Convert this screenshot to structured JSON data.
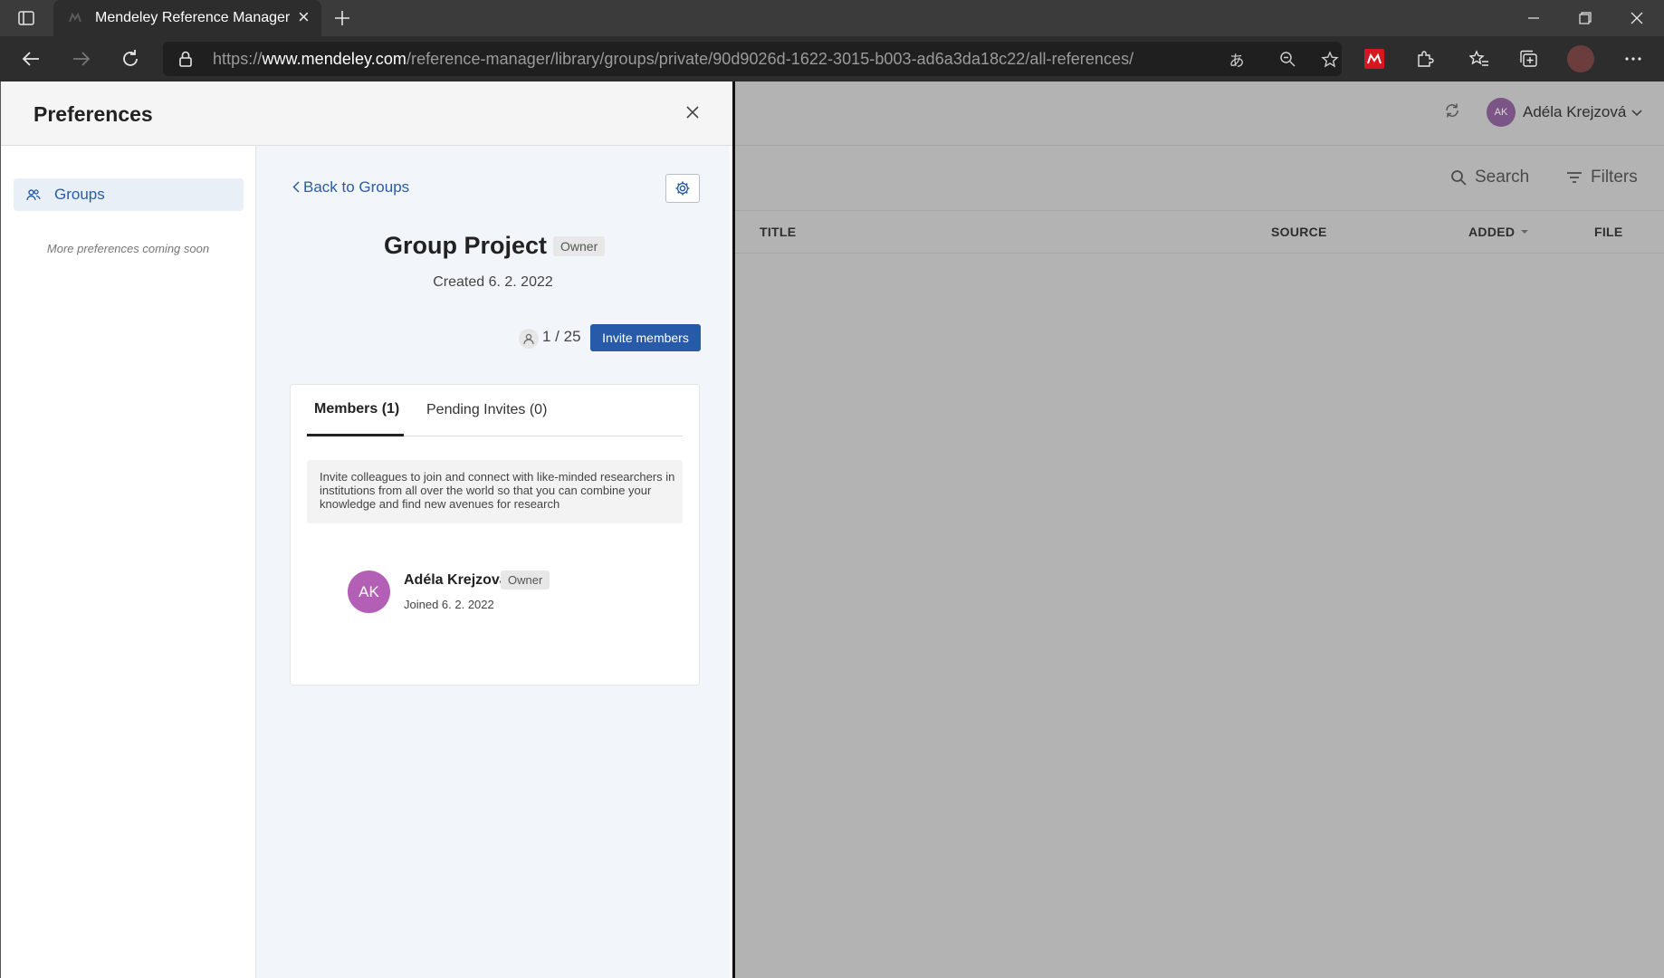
{
  "browser": {
    "tab_title": "Mendeley Reference Manager",
    "url_prefix": "https://",
    "url_host": "www.mendeley.com",
    "url_path": "/reference-manager/library/groups/private/90d9026d-1622-3015-b003-ad6a3da18c22/all-references/"
  },
  "app": {
    "user_initials": "AK",
    "user_name": "Adéla Krejzová",
    "search_label": "Search",
    "filters_label": "Filters",
    "columns": [
      "TITLE",
      "SOURCE",
      "ADDED",
      "FILE"
    ]
  },
  "modal": {
    "title": "Preferences",
    "sidebar": {
      "items": [
        {
          "label": "Groups",
          "icon": "people-icon"
        }
      ],
      "note": "More preferences coming soon"
    },
    "group": {
      "back_label": "Back to Groups",
      "name": "Group Project",
      "role": "Owner",
      "created": "Created 6. 2. 2022",
      "member_count": "1 / 25",
      "invite_label": "Invite members",
      "tabs": {
        "members": "Members (1)",
        "pending": "Pending Invites (0)"
      },
      "info": "Invite colleagues to join and connect with like-minded researchers in institutions from all over the world so that you can combine your knowledge and find new avenues for research",
      "members": [
        {
          "initials": "AK",
          "name": "Adéla Krejzová",
          "role": "Owner",
          "joined": "Joined 6. 2. 2022"
        }
      ]
    }
  },
  "colors": {
    "accent": "#275aa8",
    "avatar": "#b35fb6",
    "overlay": "#b3b3b3"
  }
}
